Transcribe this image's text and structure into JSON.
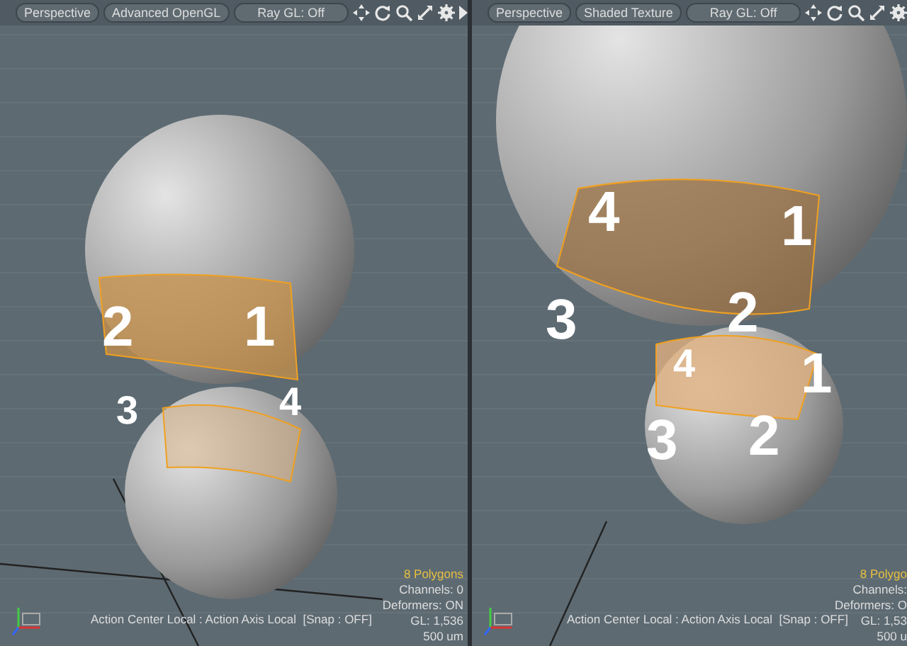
{
  "viewports": [
    {
      "toolbar": {
        "buttons": [
          "Perspective",
          "Advanced OpenGL",
          "Ray GL: Off"
        ]
      },
      "labels": [
        {
          "text": "2",
          "kind": "large"
        },
        {
          "text": "1",
          "kind": "large"
        },
        {
          "text": "3",
          "kind": "small"
        },
        {
          "text": "4",
          "kind": "small"
        }
      ],
      "status": "Action Center Local : Action Axis Local  [Snap : OFF]",
      "stats": [
        {
          "text": "8 Polygons",
          "kind": "selection"
        },
        {
          "text": "Channels: 0",
          "kind": "info"
        },
        {
          "text": "Deformers: ON",
          "kind": "info"
        },
        {
          "text": "GL: 1,536",
          "kind": "info"
        },
        {
          "text": "500 um",
          "kind": "info"
        }
      ]
    },
    {
      "toolbar": {
        "buttons": [
          "Perspective",
          "Shaded Texture",
          "Ray GL: Off"
        ]
      },
      "labels": [
        {
          "text": "4",
          "kind": "large"
        },
        {
          "text": "1",
          "kind": "large"
        },
        {
          "text": "3",
          "kind": "large"
        },
        {
          "text": "2",
          "kind": "large"
        },
        {
          "text": "4",
          "kind": "small"
        },
        {
          "text": "1",
          "kind": "large"
        },
        {
          "text": "3",
          "kind": "large"
        },
        {
          "text": "2",
          "kind": "large"
        }
      ],
      "status": "Action Center Local : Action Axis Local  [Snap : OFF]",
      "stats": [
        {
          "text": "8 Polygo",
          "kind": "selection"
        },
        {
          "text": "Channels:",
          "kind": "info"
        },
        {
          "text": "Deformers: O",
          "kind": "info"
        },
        {
          "text": "GL: 1,53",
          "kind": "info"
        },
        {
          "text": "500 u",
          "kind": "info"
        }
      ]
    }
  ]
}
